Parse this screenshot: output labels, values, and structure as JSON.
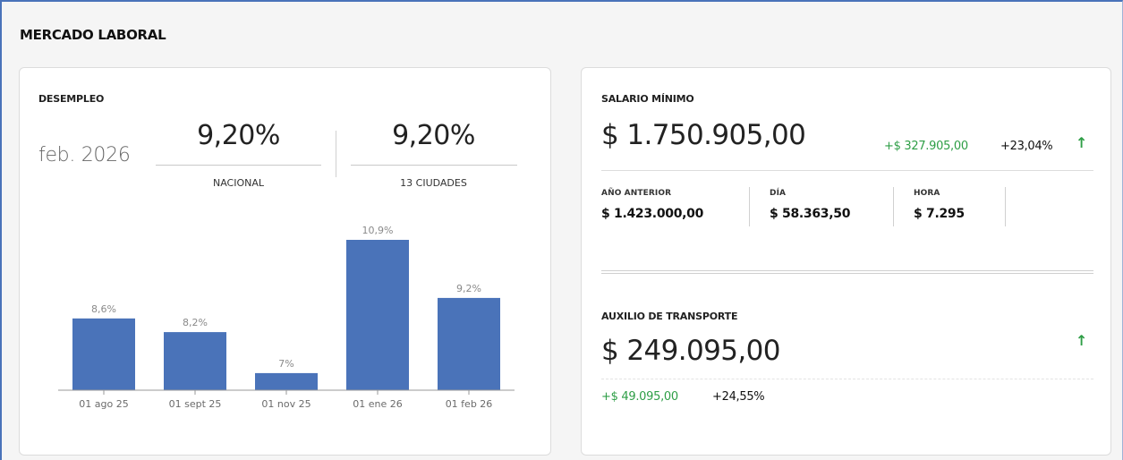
{
  "section": {
    "title": "MERCADO LABORAL"
  },
  "desempleo": {
    "title": "DESEMPLEO",
    "date": "feb. 2026",
    "nacional": {
      "value": "9,20%",
      "label": "NACIONAL"
    },
    "ciudades": {
      "value": "9,20%",
      "label": "13 CIUDADES"
    }
  },
  "chart_data": {
    "type": "bar",
    "categories": [
      "01 ago 25",
      "01 sept 25",
      "01 nov 25",
      "01 ene 26",
      "01 feb 26"
    ],
    "values": [
      8.6,
      8.2,
      7,
      10.9,
      9.2
    ],
    "value_labels": [
      "8,6%",
      "8,2%",
      "7%",
      "10,9%",
      "9,2%"
    ],
    "title": "",
    "xlabel": "",
    "ylabel": "",
    "bar_color": "#4a73b9",
    "grid": false
  },
  "salario": {
    "title": "SALARIO MÍNIMO",
    "value": "$ 1.750.905,00",
    "delta_abs": "+$ 327.905,00",
    "delta_pct": "+23,04%",
    "trend_icon": "arrow-up-icon",
    "anterior_label": "AÑO ANTERIOR",
    "anterior_value": "$ 1.423.000,00",
    "dia_label": "DÍA",
    "dia_value": "$ 58.363,50",
    "hora_label": "HORA",
    "hora_value": "$ 7.295"
  },
  "transporte": {
    "title": "AUXILIO DE TRANSPORTE",
    "value": "$ 249.095,00",
    "delta_abs": "+$ 49.095,00",
    "delta_pct": "+24,55%",
    "trend_icon": "arrow-up-icon"
  },
  "colors": {
    "accent": "#4a73b9",
    "positive": "#2e9e46"
  }
}
